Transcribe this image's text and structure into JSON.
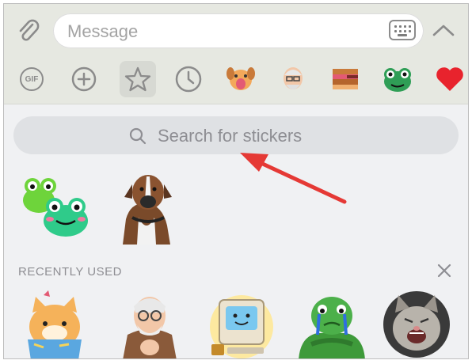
{
  "composer": {
    "placeholder": "Message",
    "attach_icon": "paperclip-icon",
    "keyboard_icon": "keyboard-icon",
    "expand_icon": "chevron-up-icon"
  },
  "tabs": [
    {
      "name": "gif",
      "label": "GIF",
      "icon": "gif-icon"
    },
    {
      "name": "add",
      "icon": "plus-icon"
    },
    {
      "name": "favorites",
      "icon": "star-icon",
      "selected": true
    },
    {
      "name": "recent",
      "icon": "clock-icon"
    },
    {
      "name": "pack-dog",
      "icon": "dog-sticker-icon"
    },
    {
      "name": "pack-old-man",
      "icon": "old-man-sticker-icon"
    },
    {
      "name": "pack-cake",
      "icon": "cake-sticker-icon"
    },
    {
      "name": "pack-frog",
      "icon": "frog-sticker-icon"
    },
    {
      "name": "pack-heart",
      "icon": "heart-sticker-icon"
    }
  ],
  "search": {
    "placeholder": "Search for stickers",
    "icon": "search-icon"
  },
  "favorites": [
    {
      "name": "frogs-sticker"
    },
    {
      "name": "boxer-dog-sticker"
    }
  ],
  "recent": {
    "title": "RECENTLY USED",
    "clear_icon": "close-icon",
    "items": [
      {
        "name": "cat-in-box-sticker"
      },
      {
        "name": "old-man-clapping-sticker"
      },
      {
        "name": "computer-sticker"
      },
      {
        "name": "crying-frog-sticker"
      },
      {
        "name": "laughing-cat-sticker"
      }
    ]
  },
  "colors": {
    "accent_arrow": "#e53935",
    "topbar_bg": "#e6e8e1",
    "panel_bg": "#f0f1f3",
    "search_bg": "#dfe1e4"
  }
}
